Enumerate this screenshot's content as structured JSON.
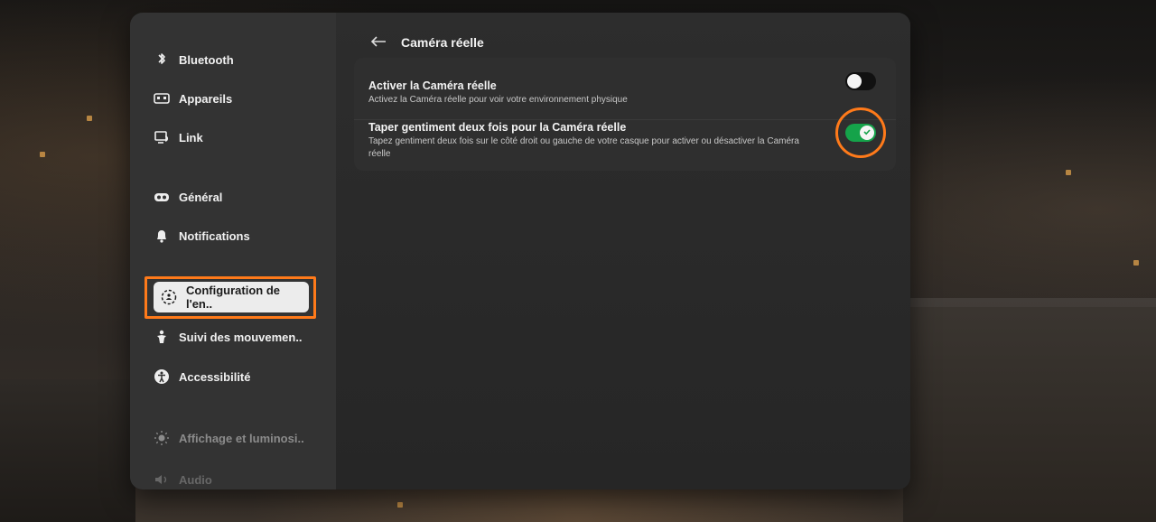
{
  "sidebar": {
    "items": [
      {
        "label": "Bluetooth",
        "icon": "bluetooth-icon"
      },
      {
        "label": "Appareils",
        "icon": "devices-icon"
      },
      {
        "label": "Link",
        "icon": "link-icon"
      },
      {
        "label": "Général",
        "icon": "headset-icon"
      },
      {
        "label": "Notifications",
        "icon": "bell-icon"
      },
      {
        "label": "Configuration de l'en..",
        "icon": "boundary-icon",
        "selected": true
      },
      {
        "label": "Suivi des mouvemen..",
        "icon": "movement-icon"
      },
      {
        "label": "Accessibilité",
        "icon": "accessibility-icon"
      },
      {
        "label": "Affichage et luminosi..",
        "icon": "brightness-icon"
      },
      {
        "label": "Audio",
        "icon": "audio-icon"
      }
    ]
  },
  "header": {
    "title": "Caméra réelle",
    "back_icon": "arrow-left-icon"
  },
  "settings": [
    {
      "title": "Activer la Caméra réelle",
      "description": "Activez la Caméra réelle pour voir votre environnement physique",
      "toggle_state": "off"
    },
    {
      "title": "Taper gentiment deux fois pour la Caméra réelle",
      "description": "Tapez gentiment deux fois sur le côté droit ou gauche de votre casque pour activer ou désactiver la Caméra réelle",
      "toggle_state": "on"
    }
  ],
  "colors": {
    "highlight": "#ff7a1a",
    "toggle_on": "#15a34a",
    "toggle_off": "#111111"
  }
}
